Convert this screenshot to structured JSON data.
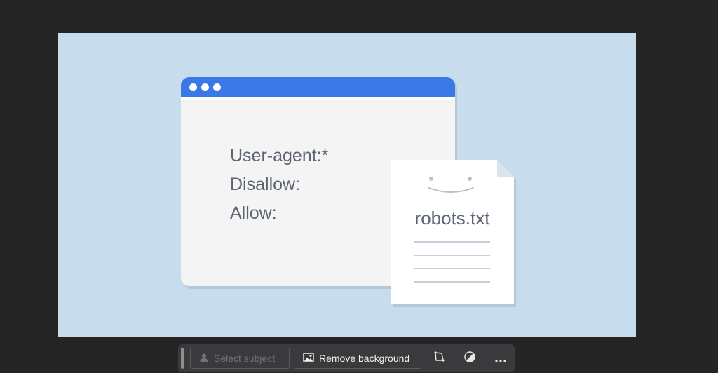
{
  "canvas": {
    "background_color": "#c7dcec",
    "browser": {
      "bar_color": "#3b78e7",
      "lines": [
        "User-agent:*",
        "Disallow:",
        "Allow:"
      ]
    },
    "document": {
      "filename": "robots.txt"
    }
  },
  "toolbar": {
    "select_subject_label": "Select subject",
    "remove_background_label": "Remove background",
    "icons": [
      "person-icon",
      "image-icon",
      "crop-icon",
      "contrast-icon",
      "more-icon"
    ]
  }
}
